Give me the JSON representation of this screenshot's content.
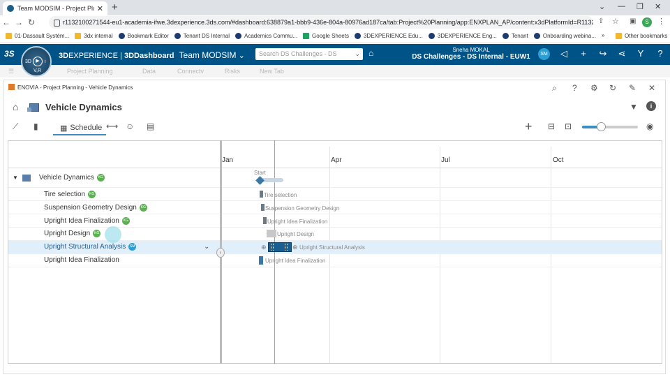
{
  "browser": {
    "tab_title": "Team MODSIM - Project Planning",
    "new_tab": "+",
    "url": "r1132100271544-eu1-academia-ifwe.3dexperience.3ds.com/#dashboard:638879a1-bbb9-436e-804a-80976ad187ca/tab:Project%20Planning/app:ENXPLAN_AP/content:x3dPlatformId=R11321002...",
    "bookmarks": [
      "01-Dassault Systém...",
      "3dx internal",
      "Bookmark Editor",
      "Tenant DS Internal",
      "Academics Commu...",
      "Google Sheets",
      "3DEXPERIENCE Edu...",
      "3DEXPERIENCE Eng...",
      "Tenant",
      "Onboarding webina..."
    ],
    "more": "»",
    "other_bookmarks": "Other bookmarks",
    "profile_initial": "S"
  },
  "platform": {
    "brand_3d": "3D",
    "brand_rest": "EXPERIENCE | ",
    "brand_app": "3DDashboard",
    "dashboard": "Team MODSIM",
    "search_placeholder": "Search DS Challenges - DS",
    "user_name": "Sneha MOKAL",
    "platform_name": "DS Challenges - DS Internal - EUW1",
    "avatar_initials": "SM",
    "compass_v": "V,R",
    "compass_3d": "3D",
    "compass_i": "i"
  },
  "subtabs": [
    "Project Planning",
    "Data",
    "Connectv",
    "Risks",
    "New Tab"
  ],
  "widget": {
    "header": "ENOVIA - Project Planning - Vehicle Dynamics",
    "title": "Vehicle Dynamics",
    "schedule_tab": "Schedule"
  },
  "gantt": {
    "months": [
      "Jan",
      "Apr",
      "Jul",
      "Oct"
    ],
    "start_label": "Start",
    "root": {
      "label": "Vehicle Dynamics",
      "badge": "KG"
    },
    "tasks": [
      {
        "label": "Tire selection",
        "badge": "KG",
        "bar": "Tire selection"
      },
      {
        "label": "Suspension Geometry Design",
        "badge": "KG",
        "bar": "Suspension Geometry Design"
      },
      {
        "label": "Upright Idea Finalization",
        "badge": "KG",
        "bar": "Upright Idea Finalization"
      },
      {
        "label": "Upright Design",
        "badge": "KG",
        "bar": "Upright Design"
      },
      {
        "label": "Upright Structural Analysis",
        "badge": "SM",
        "bar": "Upright Structural Analysis",
        "selected": true
      },
      {
        "label": "Upright Idea Finalization",
        "badge": "",
        "bar": "Upright Idea Finalization"
      }
    ]
  },
  "colors": {
    "topbar": "#005386",
    "accent": "#3d8dc4",
    "today": "#d9534f",
    "badge_green": "#5ab14f",
    "badge_blue": "#2a9fd6"
  },
  "icons": {
    "home": "home-icon",
    "zoom": "zoom-slider",
    "eye": "eye-icon"
  }
}
